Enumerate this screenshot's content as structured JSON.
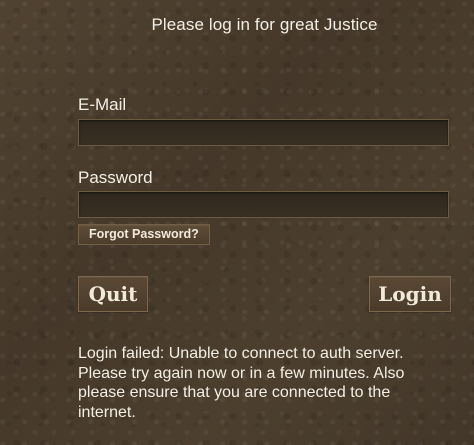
{
  "login": {
    "title": "Please log in for great Justice",
    "email_label": "E-Mail",
    "email_value": "",
    "password_label": "Password",
    "password_value": "",
    "forgot_label": "Forgot Password?",
    "quit_label": "Quit",
    "login_label": "Login",
    "error_message": "Login failed: Unable to connect to auth server. Please try again now or in a few minutes. Also please ensure that you are connected to the internet."
  },
  "colors": {
    "background": "#4a3d2c",
    "field_background": "#2f271d",
    "button_background": "#5a4834",
    "text": "#f4efe4"
  }
}
